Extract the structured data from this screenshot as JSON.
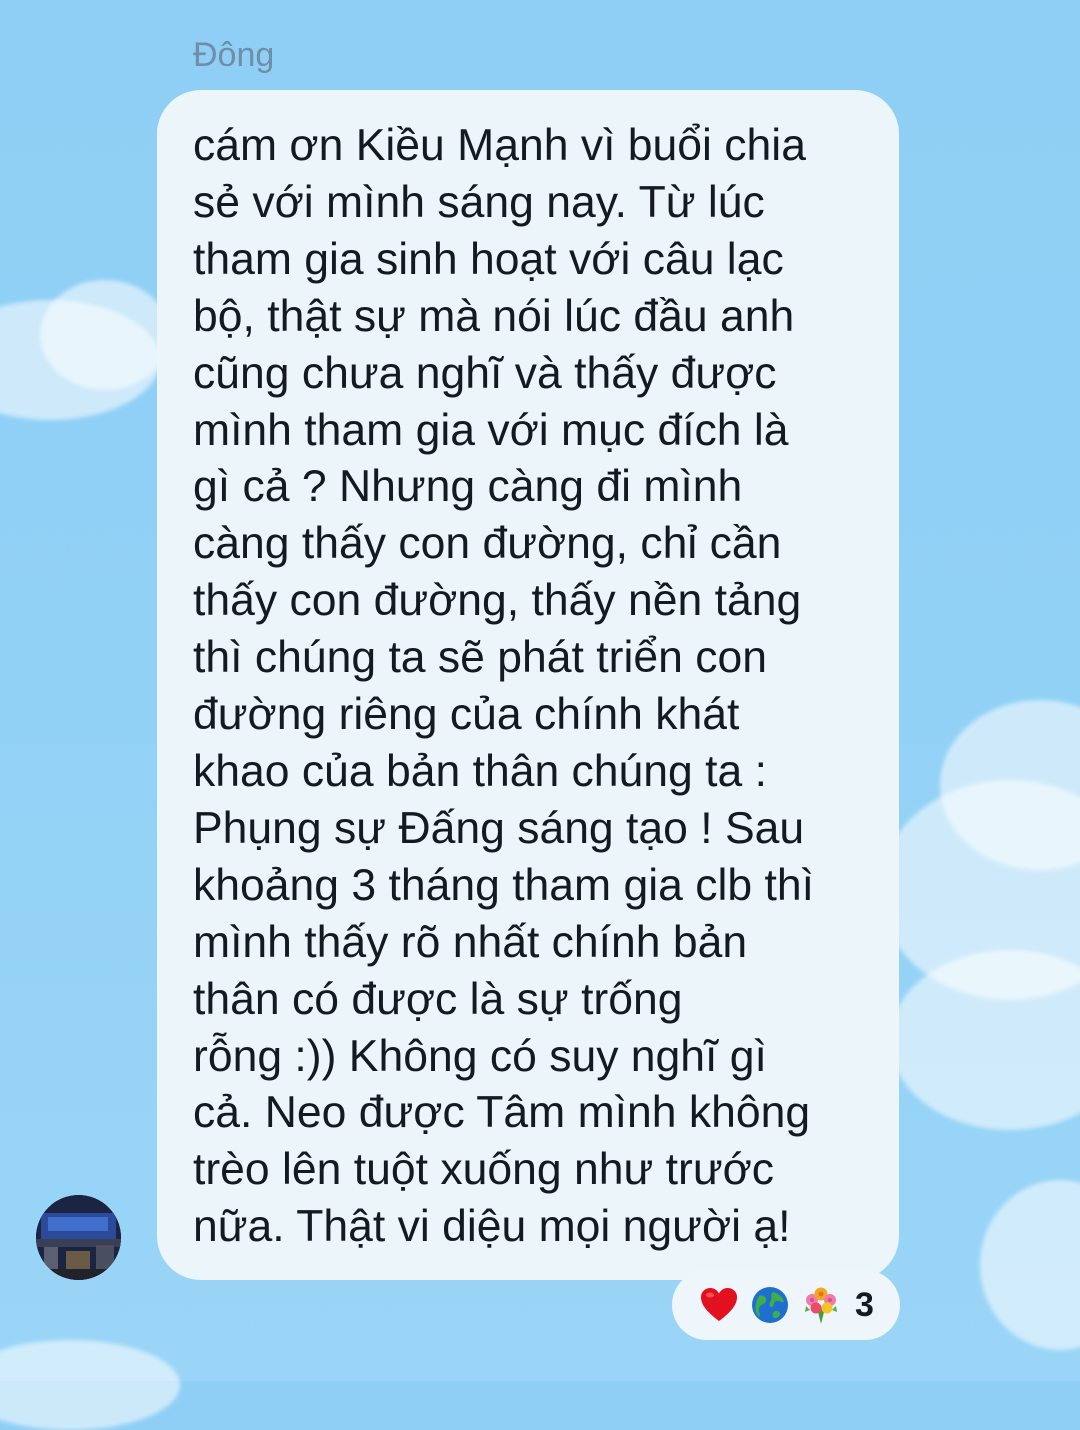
{
  "message": {
    "sender_name": "Đông",
    "text": "cám ơn Kiều Mạnh vì buổi chia\nsẻ với mình sáng nay. Từ lúc\ntham gia sinh hoạt với câu lạc\nbộ, thật sự mà nói lúc đầu anh\ncũng chưa nghĩ và thấy được\nmình tham gia với mục đích là\ngì cả ? Nhưng càng đi mình\ncàng thấy con đường, chỉ cần\nthấy con đường, thấy nền tảng\nthì chúng ta sẽ phát triển con\nđường riêng của chính khát\nkhao của bản thân chúng ta :\nPhụng sự Đấng sáng tạo ! Sau\nkhoảng 3 tháng tham gia clb thì\nmình thấy rõ nhất chính bản\nthân có được là sự trống\nrỗng :)) Không có suy nghĩ gì\ncả. Neo được Tâm mình không\ntrèo lên tuột xuống như trước\nnữa. Thật vi diệu mọi người ạ!"
  },
  "reactions": {
    "icons": [
      "heart-icon",
      "globe-icon",
      "bouquet-icon"
    ],
    "count": "3"
  },
  "colors": {
    "background": "#92d1f6",
    "bubble": "#ecf5fa",
    "sender_name": "#6f8ea8",
    "text": "#141a22",
    "heart": "#e3101f"
  }
}
